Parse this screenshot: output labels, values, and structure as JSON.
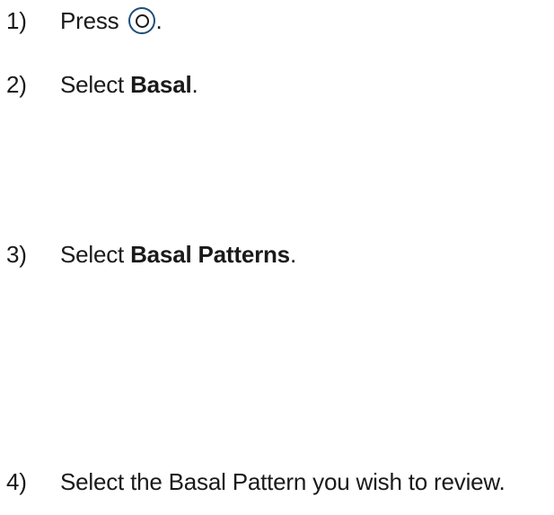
{
  "steps": [
    {
      "number": "1)",
      "text_before": "Press ",
      "icon": "select-button-icon",
      "text_after": "."
    },
    {
      "number": "2)",
      "text_before": "Select ",
      "bold": "Basal",
      "text_after": "."
    },
    {
      "number": "3)",
      "text_before": "Select ",
      "bold": "Basal Patterns",
      "text_after": "."
    },
    {
      "number": "4)",
      "text": "Select the Basal Pattern you wish to review."
    }
  ],
  "colors": {
    "text": "#1a1a1a",
    "button_ring": "#1f4e7a"
  }
}
